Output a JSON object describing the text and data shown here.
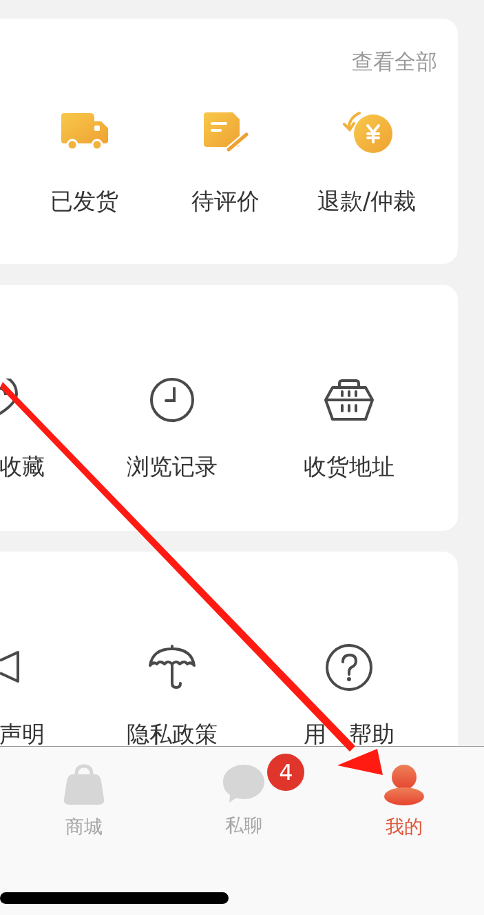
{
  "orders": {
    "view_all": "查看全部",
    "items": [
      {
        "label": "已发货"
      },
      {
        "label": "待评价"
      },
      {
        "label": "退款/仲裁"
      }
    ]
  },
  "services": {
    "items": [
      {
        "label": "收藏"
      },
      {
        "label": "浏览记录"
      },
      {
        "label": "收货地址"
      }
    ]
  },
  "info": {
    "items": [
      {
        "label": "声明"
      },
      {
        "label": "隐私政策"
      },
      {
        "label_parts": [
          "用",
          "帮助"
        ]
      }
    ]
  },
  "tab_bar": [
    {
      "label": "商城",
      "selected": false
    },
    {
      "label": "私聊",
      "selected": false,
      "badge": "4"
    },
    {
      "label": "我的",
      "selected": true
    }
  ]
}
